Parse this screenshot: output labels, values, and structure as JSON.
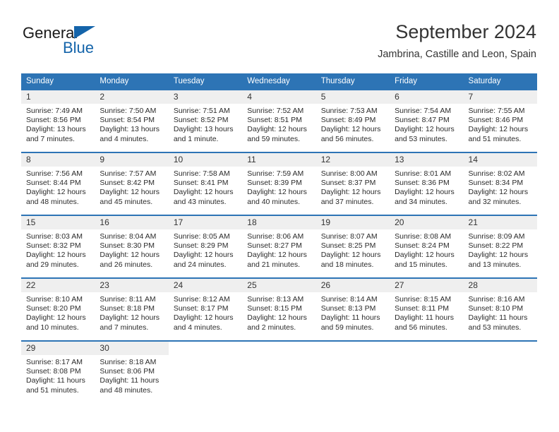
{
  "brand": {
    "name_part1": "General",
    "name_part2": "Blue",
    "accent_color": "#1464aa"
  },
  "header": {
    "title": "September 2024",
    "subtitle": "Jambrina, Castille and Leon, Spain",
    "header_bg_color": "#2d74b5",
    "daynum_bg_color": "#efefef"
  },
  "weekdays": [
    "Sunday",
    "Monday",
    "Tuesday",
    "Wednesday",
    "Thursday",
    "Friday",
    "Saturday"
  ],
  "weeks": [
    [
      {
        "day": "1",
        "sunrise": "Sunrise: 7:49 AM",
        "sunset": "Sunset: 8:56 PM",
        "daylight": "Daylight: 13 hours and 7 minutes."
      },
      {
        "day": "2",
        "sunrise": "Sunrise: 7:50 AM",
        "sunset": "Sunset: 8:54 PM",
        "daylight": "Daylight: 13 hours and 4 minutes."
      },
      {
        "day": "3",
        "sunrise": "Sunrise: 7:51 AM",
        "sunset": "Sunset: 8:52 PM",
        "daylight": "Daylight: 13 hours and 1 minute."
      },
      {
        "day": "4",
        "sunrise": "Sunrise: 7:52 AM",
        "sunset": "Sunset: 8:51 PM",
        "daylight": "Daylight: 12 hours and 59 minutes."
      },
      {
        "day": "5",
        "sunrise": "Sunrise: 7:53 AM",
        "sunset": "Sunset: 8:49 PM",
        "daylight": "Daylight: 12 hours and 56 minutes."
      },
      {
        "day": "6",
        "sunrise": "Sunrise: 7:54 AM",
        "sunset": "Sunset: 8:47 PM",
        "daylight": "Daylight: 12 hours and 53 minutes."
      },
      {
        "day": "7",
        "sunrise": "Sunrise: 7:55 AM",
        "sunset": "Sunset: 8:46 PM",
        "daylight": "Daylight: 12 hours and 51 minutes."
      }
    ],
    [
      {
        "day": "8",
        "sunrise": "Sunrise: 7:56 AM",
        "sunset": "Sunset: 8:44 PM",
        "daylight": "Daylight: 12 hours and 48 minutes."
      },
      {
        "day": "9",
        "sunrise": "Sunrise: 7:57 AM",
        "sunset": "Sunset: 8:42 PM",
        "daylight": "Daylight: 12 hours and 45 minutes."
      },
      {
        "day": "10",
        "sunrise": "Sunrise: 7:58 AM",
        "sunset": "Sunset: 8:41 PM",
        "daylight": "Daylight: 12 hours and 43 minutes."
      },
      {
        "day": "11",
        "sunrise": "Sunrise: 7:59 AM",
        "sunset": "Sunset: 8:39 PM",
        "daylight": "Daylight: 12 hours and 40 minutes."
      },
      {
        "day": "12",
        "sunrise": "Sunrise: 8:00 AM",
        "sunset": "Sunset: 8:37 PM",
        "daylight": "Daylight: 12 hours and 37 minutes."
      },
      {
        "day": "13",
        "sunrise": "Sunrise: 8:01 AM",
        "sunset": "Sunset: 8:36 PM",
        "daylight": "Daylight: 12 hours and 34 minutes."
      },
      {
        "day": "14",
        "sunrise": "Sunrise: 8:02 AM",
        "sunset": "Sunset: 8:34 PM",
        "daylight": "Daylight: 12 hours and 32 minutes."
      }
    ],
    [
      {
        "day": "15",
        "sunrise": "Sunrise: 8:03 AM",
        "sunset": "Sunset: 8:32 PM",
        "daylight": "Daylight: 12 hours and 29 minutes."
      },
      {
        "day": "16",
        "sunrise": "Sunrise: 8:04 AM",
        "sunset": "Sunset: 8:30 PM",
        "daylight": "Daylight: 12 hours and 26 minutes."
      },
      {
        "day": "17",
        "sunrise": "Sunrise: 8:05 AM",
        "sunset": "Sunset: 8:29 PM",
        "daylight": "Daylight: 12 hours and 24 minutes."
      },
      {
        "day": "18",
        "sunrise": "Sunrise: 8:06 AM",
        "sunset": "Sunset: 8:27 PM",
        "daylight": "Daylight: 12 hours and 21 minutes."
      },
      {
        "day": "19",
        "sunrise": "Sunrise: 8:07 AM",
        "sunset": "Sunset: 8:25 PM",
        "daylight": "Daylight: 12 hours and 18 minutes."
      },
      {
        "day": "20",
        "sunrise": "Sunrise: 8:08 AM",
        "sunset": "Sunset: 8:24 PM",
        "daylight": "Daylight: 12 hours and 15 minutes."
      },
      {
        "day": "21",
        "sunrise": "Sunrise: 8:09 AM",
        "sunset": "Sunset: 8:22 PM",
        "daylight": "Daylight: 12 hours and 13 minutes."
      }
    ],
    [
      {
        "day": "22",
        "sunrise": "Sunrise: 8:10 AM",
        "sunset": "Sunset: 8:20 PM",
        "daylight": "Daylight: 12 hours and 10 minutes."
      },
      {
        "day": "23",
        "sunrise": "Sunrise: 8:11 AM",
        "sunset": "Sunset: 8:18 PM",
        "daylight": "Daylight: 12 hours and 7 minutes."
      },
      {
        "day": "24",
        "sunrise": "Sunrise: 8:12 AM",
        "sunset": "Sunset: 8:17 PM",
        "daylight": "Daylight: 12 hours and 4 minutes."
      },
      {
        "day": "25",
        "sunrise": "Sunrise: 8:13 AM",
        "sunset": "Sunset: 8:15 PM",
        "daylight": "Daylight: 12 hours and 2 minutes."
      },
      {
        "day": "26",
        "sunrise": "Sunrise: 8:14 AM",
        "sunset": "Sunset: 8:13 PM",
        "daylight": "Daylight: 11 hours and 59 minutes."
      },
      {
        "day": "27",
        "sunrise": "Sunrise: 8:15 AM",
        "sunset": "Sunset: 8:11 PM",
        "daylight": "Daylight: 11 hours and 56 minutes."
      },
      {
        "day": "28",
        "sunrise": "Sunrise: 8:16 AM",
        "sunset": "Sunset: 8:10 PM",
        "daylight": "Daylight: 11 hours and 53 minutes."
      }
    ],
    [
      {
        "day": "29",
        "sunrise": "Sunrise: 8:17 AM",
        "sunset": "Sunset: 8:08 PM",
        "daylight": "Daylight: 11 hours and 51 minutes."
      },
      {
        "day": "30",
        "sunrise": "Sunrise: 8:18 AM",
        "sunset": "Sunset: 8:06 PM",
        "daylight": "Daylight: 11 hours and 48 minutes."
      },
      {
        "day": "",
        "sunrise": "",
        "sunset": "",
        "daylight": ""
      },
      {
        "day": "",
        "sunrise": "",
        "sunset": "",
        "daylight": ""
      },
      {
        "day": "",
        "sunrise": "",
        "sunset": "",
        "daylight": ""
      },
      {
        "day": "",
        "sunrise": "",
        "sunset": "",
        "daylight": ""
      },
      {
        "day": "",
        "sunrise": "",
        "sunset": "",
        "daylight": ""
      }
    ]
  ]
}
